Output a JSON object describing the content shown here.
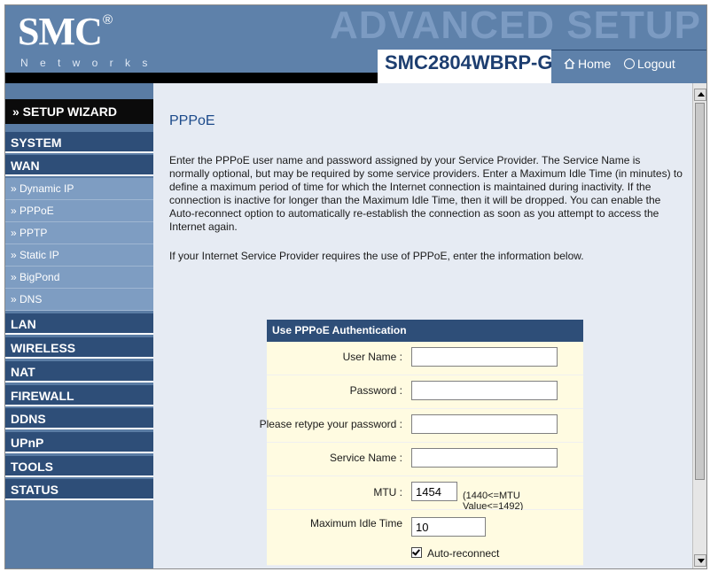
{
  "header": {
    "logo": "SMC",
    "logo_reg": "®",
    "networks": "N e t w o r k s",
    "banner": "ADVANCED SETUP",
    "model": "SMC2804WBRP-G",
    "home": "Home",
    "logout": "Logout"
  },
  "sidebar": {
    "wizard": "» SETUP WIZARD",
    "system": "SYSTEM",
    "wan": "WAN",
    "wan_items": [
      "» Dynamic IP",
      "» PPPoE",
      "» PPTP",
      "» Static IP",
      "» BigPond",
      "» DNS"
    ],
    "lan": "LAN",
    "wireless": "WIRELESS",
    "nat": "NAT",
    "firewall": "FIREWALL",
    "ddns": "DDNS",
    "upnp": "UPnP",
    "tools": "TOOLS",
    "status": "STATUS"
  },
  "content": {
    "title": "PPPoE",
    "description": "Enter the PPPoE user name and password assigned by your Service Provider. The Service Name is normally optional, but may be required by some service providers.  Enter a Maximum Idle Time (in minutes) to define a maximum period of time for which the Internet connection is maintained during inactivity.  If the connection is inactive for longer than the Maximum Idle Time, then it will be dropped.  You can enable the Auto-reconnect option to automatically re-establish the connection as soon as you attempt to access the Internet again.",
    "instruction": "If your Internet Service Provider requires the use of PPPoE, enter the information below."
  },
  "form": {
    "header": "Use PPPoE Authentication",
    "user_name_label": "User Name :",
    "user_name_value": "",
    "password_label": "Password :",
    "password_value": "",
    "retype_label": "Please retype your password :",
    "retype_value": "",
    "service_label": "Service Name :",
    "service_value": "",
    "mtu_label": "MTU :",
    "mtu_value": "1454",
    "mtu_hint": "(1440<=MTU Value<=1492)",
    "idle_label": "Maximum Idle Time",
    "idle_value": "10",
    "auto_reconnect_label": "Auto-reconnect",
    "auto_reconnect_checked": true
  },
  "colors": {
    "sidebar_bg": "#5a7ca4",
    "section_bg": "#2e4e78",
    "sub_bg": "#7e9dc2",
    "content_bg": "#e6ebf3",
    "form_row_bg": "#fffbe1"
  }
}
